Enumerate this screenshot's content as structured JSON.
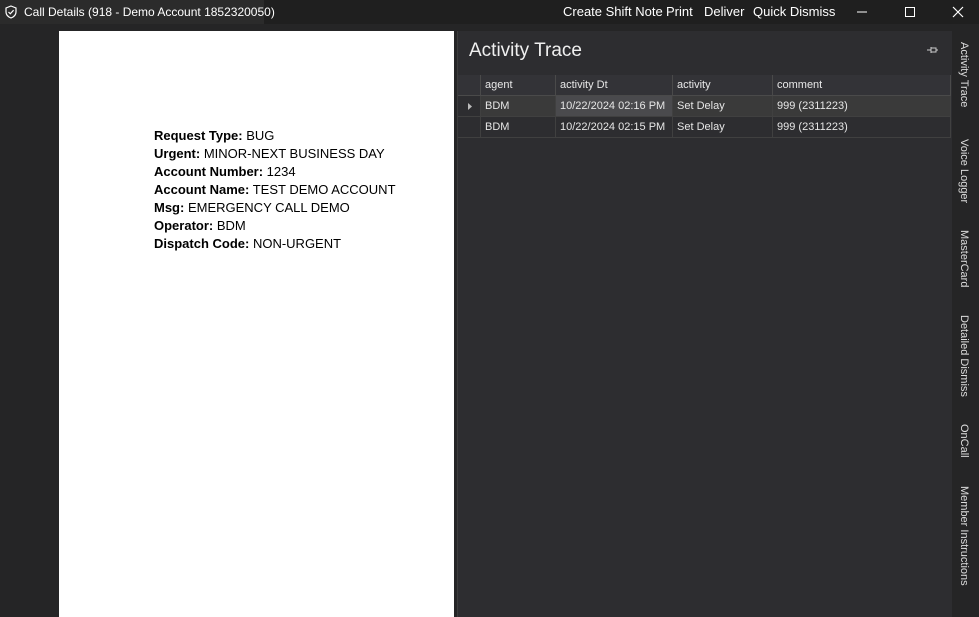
{
  "window": {
    "title": "Call Details (918 - Demo Account 1852320050)",
    "menu": [
      "Create Shift Note",
      "Print",
      "Deliver",
      "Quick Dismiss"
    ]
  },
  "document": {
    "lines": [
      {
        "label": "Request Type:",
        "value": " BUG"
      },
      {
        "label": "Urgent:",
        "value": " MINOR-NEXT BUSINESS DAY"
      },
      {
        "label": "Account Number:",
        "value": " 1234"
      },
      {
        "label": "Account Name:",
        "value": " TEST DEMO ACCOUNT"
      },
      {
        "label": "Msg:",
        "value": " EMERGENCY CALL DEMO"
      },
      {
        "label": "Operator:",
        "value": " BDM"
      },
      {
        "label": "Dispatch Code:",
        "value": " NON-URGENT"
      }
    ]
  },
  "activity_trace": {
    "title": "Activity Trace",
    "columns": [
      "agent",
      "activity Dt",
      "activity",
      "comment"
    ],
    "rows": [
      [
        "BDM",
        "10/22/2024 02:16 PM",
        "Set Delay",
        "999 (2311223)"
      ],
      [
        "BDM",
        "10/22/2024 02:15 PM",
        "Set Delay",
        "999 (2311223)"
      ]
    ]
  },
  "side_tabs": [
    "Activity Trace",
    "Voice Logger",
    "MasterCard",
    "Detailed Dismiss",
    "OnCall",
    "Member Instructions"
  ]
}
